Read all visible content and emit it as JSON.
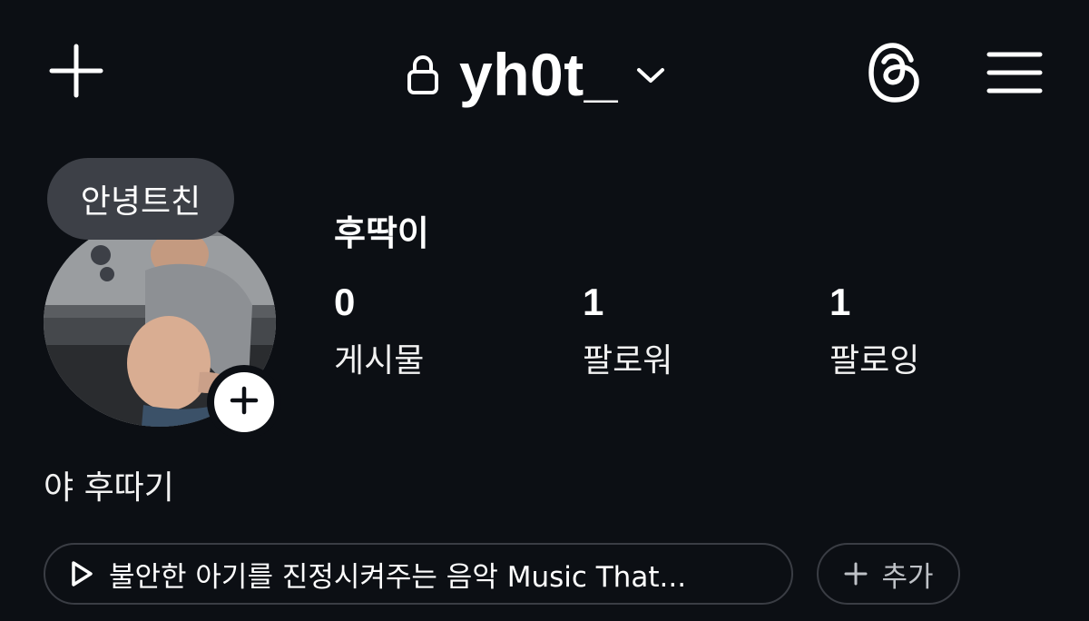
{
  "header": {
    "username": "yh0t_",
    "icons": {
      "create": "plus-icon",
      "private": "lock-icon",
      "switch_account": "chevron-down-icon",
      "threads": "threads-icon",
      "menu": "hamburger-menu-icon"
    }
  },
  "note": {
    "text": "안녕트친"
  },
  "profile": {
    "display_name": "후딱이",
    "bio": "야 후따기",
    "stats": [
      {
        "value": "0",
        "label": "게시물"
      },
      {
        "value": "1",
        "label": "팔로워"
      },
      {
        "value": "1",
        "label": "팔로잉"
      }
    ]
  },
  "music": {
    "icon": "play-icon",
    "title": "불안한 아기를 진정시켜주는 음악 Music That..."
  },
  "add_button": {
    "icon": "plus-icon",
    "label": "추가"
  },
  "colors": {
    "background": "#0c0f14",
    "text": "#ffffff",
    "bubble": "#3d4047",
    "pill_border": "#3a3d44"
  }
}
